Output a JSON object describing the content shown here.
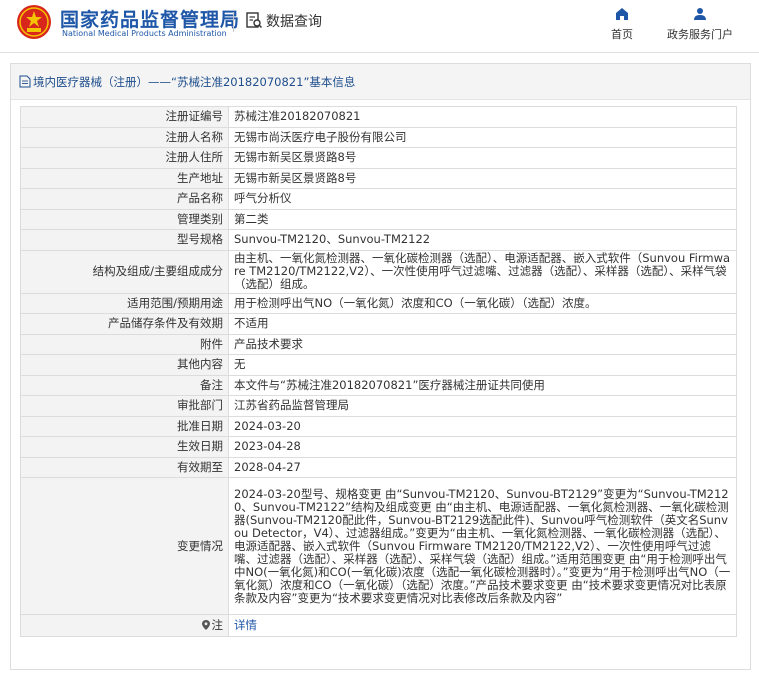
{
  "header": {
    "site_name_cn": "国家药品监督管理局",
    "site_name_en": "National Medical Products Administration",
    "section_title": "数据查询",
    "nav": [
      {
        "label": "首页",
        "icon": "home-icon"
      },
      {
        "label": "政务服务门户",
        "icon": "user-icon"
      }
    ]
  },
  "breadcrumb": {
    "text": "境内医疗器械（注册）——“苏械注准20182070821”基本信息"
  },
  "rows": [
    {
      "key": "注册证编号",
      "value": "苏械注准20182070821"
    },
    {
      "key": "注册人名称",
      "value": "无锡市尚沃医疗电子股份有限公司"
    },
    {
      "key": "注册人住所",
      "value": "无锡市新吴区景贤路8号"
    },
    {
      "key": "生产地址",
      "value": "无锡市新吴区景贤路8号"
    },
    {
      "key": "产品名称",
      "value": "呼气分析仪"
    },
    {
      "key": "管理类别",
      "value": "第二类"
    },
    {
      "key": "型号规格",
      "value": "Sunvou-TM2120、Sunvou-TM2122"
    },
    {
      "key": "结构及组成/主要组成成分",
      "value": "由主机、一氧化氮检测器、一氧化碳检测器（选配）、电源适配器、嵌入式软件（Sunvou Firmware TM2120/TM2122,V2）、一次性使用呼气过滤嘴、过滤器（选配）、采样器（选配）、采样气袋（选配）组成。"
    },
    {
      "key": "适用范围/预期用途",
      "value": "用于检测呼出气NO（一氧化氮）浓度和CO（一氧化碳）（选配）浓度。"
    },
    {
      "key": "产品储存条件及有效期",
      "value": "不适用"
    },
    {
      "key": "附件",
      "value": "产品技术要求"
    },
    {
      "key": "其他内容",
      "value": "无"
    },
    {
      "key": "备注",
      "value": "本文件与“苏械注准20182070821”医疗器械注册证共同使用"
    },
    {
      "key": "审批部门",
      "value": "江苏省药品监督管理局"
    },
    {
      "key": "批准日期",
      "value": "2024-03-20"
    },
    {
      "key": "生效日期",
      "value": "2023-04-28"
    },
    {
      "key": "有效期至",
      "value": "2028-04-27"
    },
    {
      "key": "变更情况",
      "value": "2024-03-20型号、规格变更 由“Sunvou-TM2120、Sunvou-BT2129”变更为“Sunvou-TM2120、Sunvou-TM2122”结构及组成变更 由“由主机、电源适配器、一氧化氮检测器、一氧化碳检测器(Sunvou-TM2120配此件，Sunvou-BT2129选配此件)、Sunvou呼气检测软件（英文名Sunvou Detector，V4）、过滤器组成。”变更为“由主机、一氧化氮检测器、一氧化碳检测器（选配）、电源适配器、嵌入式软件（Sunvou Firmware TM2120/TM2122,V2）、一次性使用呼气过滤嘴、过滤器（选配）、采样器（选配）、采样气袋（选配）组成。”适用范围变更 由“用于检测呼出气中NO(一氧化氮)和CO(一氧化碳)浓度（选配一氧化碳检测器时）。”变更为“用于检测呼出气NO（一氧化氮）浓度和CO（一氧化碳）（选配）浓度。”产品技术要求变更 由“技术要求变更情况对比表原条款及内容”变更为“技术要求变更情况对比表修改后条款及内容”"
    }
  ],
  "note_row": {
    "key": "注",
    "icon": "pin-icon",
    "link_label": "详情"
  },
  "colors": {
    "brand_blue": "#1f57a8",
    "emblem_red": "#d9261c",
    "emblem_gold": "#f5c400"
  }
}
